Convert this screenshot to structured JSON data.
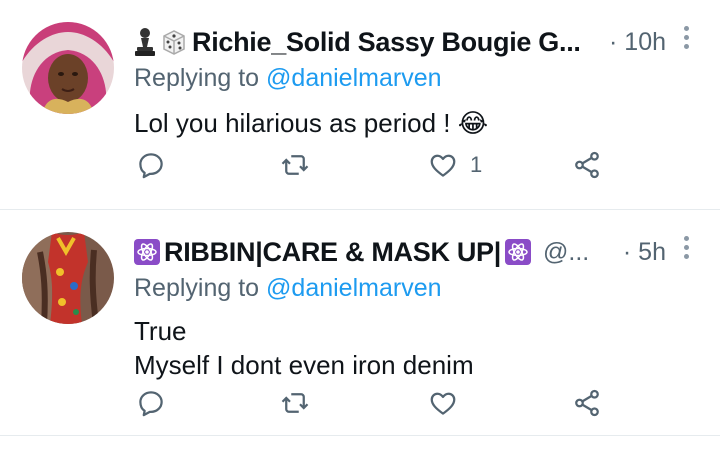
{
  "tweets": [
    {
      "display_name": "Richie_Solid Sassy Bougie G...",
      "name_prefix_icons": [
        "chess-pawn-icon",
        "dice-icon"
      ],
      "handle": "",
      "time": "· 10h",
      "replying_label": "Replying to ",
      "replying_handle": "@danielmarven",
      "text_lines": [
        "Lol you hilarious as period ! 😂"
      ],
      "like_count": "1"
    },
    {
      "display_name": "RIBBIN|CARE & MASK UP|",
      "name_prefix_icons": [
        "atom-icon"
      ],
      "name_suffix_icons": [
        "atom-icon"
      ],
      "handle": "@...",
      "time": "· 5h",
      "replying_label": "Replying to ",
      "replying_handle": "@danielmarven",
      "text_lines": [
        "True",
        "Myself I dont even iron denim"
      ],
      "like_count": ""
    }
  ],
  "colors": {
    "link": "#1d9bf0",
    "muted": "#536471",
    "atom_badge": "#8a4cc7"
  }
}
